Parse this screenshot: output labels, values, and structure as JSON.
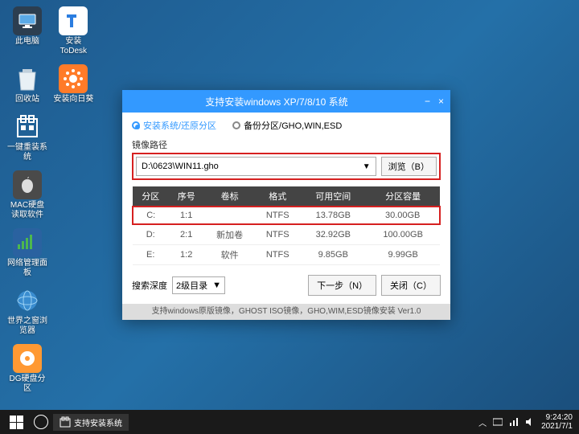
{
  "desktop": {
    "icons": [
      {
        "name": "thispc",
        "label": "此电脑"
      },
      {
        "name": "todesk",
        "label": "安装ToDesk"
      },
      {
        "name": "recycle",
        "label": "回收站"
      },
      {
        "name": "sunflower",
        "label": "安装向日葵"
      },
      {
        "name": "reinstall",
        "label": "一键重装系统"
      },
      {
        "name": "macdisk",
        "label": "MAC硬盘读取软件"
      },
      {
        "name": "netmgr",
        "label": "网络管理面板"
      },
      {
        "name": "worldwin",
        "label": "世界之窗浏览器"
      },
      {
        "name": "dg",
        "label": "DG硬盘分区"
      }
    ]
  },
  "window": {
    "title": "支持安装windows XP/7/8/10 系统",
    "minimize": "−",
    "close": "×",
    "radio_install": "安装系统/还原分区",
    "radio_backup": "备份分区/GHO,WIN,ESD",
    "image_path_label": "镜像路径",
    "image_path_value": "D:\\0623\\WIN11.gho",
    "browse_label": "浏览（B）",
    "table": {
      "headers": [
        "分区",
        "序号",
        "卷标",
        "格式",
        "可用空间",
        "分区容量"
      ],
      "rows": [
        {
          "drive": "C:",
          "index": "1:1",
          "volume": "",
          "fs": "NTFS",
          "free": "13.78GB",
          "total": "30.00GB",
          "highlight": true
        },
        {
          "drive": "D:",
          "index": "2:1",
          "volume": "新加卷",
          "fs": "NTFS",
          "free": "32.92GB",
          "total": "100.00GB"
        },
        {
          "drive": "E:",
          "index": "1:2",
          "volume": "软件",
          "fs": "NTFS",
          "free": "9.85GB",
          "total": "9.99GB"
        }
      ]
    },
    "search_depth_label": "搜索深度",
    "search_depth_value": "2级目录",
    "next_label": "下一步（N）",
    "close_label": "关闭（C）",
    "statusbar": "支持windows原版镜像，GHOST ISO镜像，GHO,WIM,ESD镜像安装 Ver1.0"
  },
  "taskbar": {
    "app_label": "支持安装系统",
    "time": "9:24:20",
    "date": "2021/7/1"
  }
}
